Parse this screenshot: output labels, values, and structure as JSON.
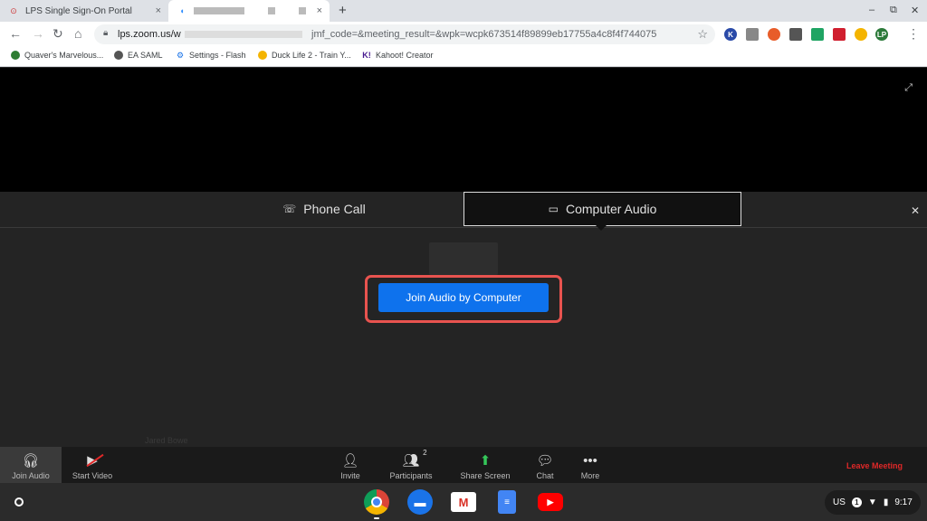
{
  "browser": {
    "tabs": [
      {
        "title": "LPS Single Sign-On Portal",
        "close": "×"
      },
      {
        "title": "",
        "close": "×"
      }
    ],
    "new_tab": "+",
    "window_controls": [
      "–",
      "⧉",
      "✕"
    ],
    "nav": {
      "back": "←",
      "forward": "→",
      "reload": "↻",
      "home": "⌂"
    },
    "url_visible_start": "lps.zoom.us/w",
    "url_visible_end": "jmf_code=&meeting_result=&wpk=wcpk673514f89899eb17755a4c8f4f744075",
    "star": "☆",
    "extensions": [
      {
        "icon": "kahoot-ext-icon",
        "label": "K",
        "color": "#2a4aa8"
      },
      {
        "icon": "copy-ext-icon",
        "label": "",
        "color": "#888888"
      },
      {
        "icon": "grammar-ext-icon",
        "label": "",
        "color": "#e85d2a"
      },
      {
        "icon": "feather-ext-icon",
        "label": "",
        "color": "#555555"
      },
      {
        "icon": "drive-ext-icon",
        "label": "",
        "color": "#1fa463"
      },
      {
        "icon": "ruby-ext-icon",
        "label": "",
        "color": "#d01f2f"
      },
      {
        "icon": "color-ext-icon",
        "label": "",
        "color": "#f4b400"
      },
      {
        "icon": "lp-ext-icon",
        "label": "LP",
        "color": "#2c7a3a"
      }
    ],
    "menu": "⋮",
    "bookmarks": [
      {
        "label": "Quaver's Marvelous...",
        "icon": "quaver-icon",
        "color": "#2e7d32"
      },
      {
        "label": "EA SAML",
        "icon": "globe-icon",
        "color": "#555555"
      },
      {
        "label": "Settings - Flash",
        "icon": "gear-icon",
        "color": "#1a73e8"
      },
      {
        "label": "Duck Life 2 - Train Y...",
        "icon": "duck-icon",
        "color": "#f4b400"
      },
      {
        "label": "Kahoot! Creator",
        "icon": "kahoot-icon",
        "color": "#46178f"
      }
    ]
  },
  "meeting": {
    "audio_tabs": {
      "phone": "Phone Call",
      "computer": "Computer Audio"
    },
    "join_button": "Join Audio by Computer",
    "faint_name": "Jared Bowe",
    "toolbar": {
      "join_audio": "Join Audio",
      "start_video": "Start Video",
      "invite": "Invite",
      "participants": "Participants",
      "participants_count": "2",
      "share_screen": "Share Screen",
      "chat": "Chat",
      "more": "More",
      "leave": "Leave Meeting"
    }
  },
  "shelf": {
    "apps": [
      {
        "name": "chrome-app-icon",
        "color": "#db4437"
      },
      {
        "name": "files-app-icon",
        "color": "#1a73e8"
      },
      {
        "name": "gmail-app-icon",
        "color": "#ffffff"
      },
      {
        "name": "docs-app-icon",
        "color": "#4285f4"
      },
      {
        "name": "youtube-app-icon",
        "color": "#ff0000"
      }
    ],
    "tray": {
      "keyboard": "US",
      "notifications": "1",
      "time": "9:17"
    }
  }
}
